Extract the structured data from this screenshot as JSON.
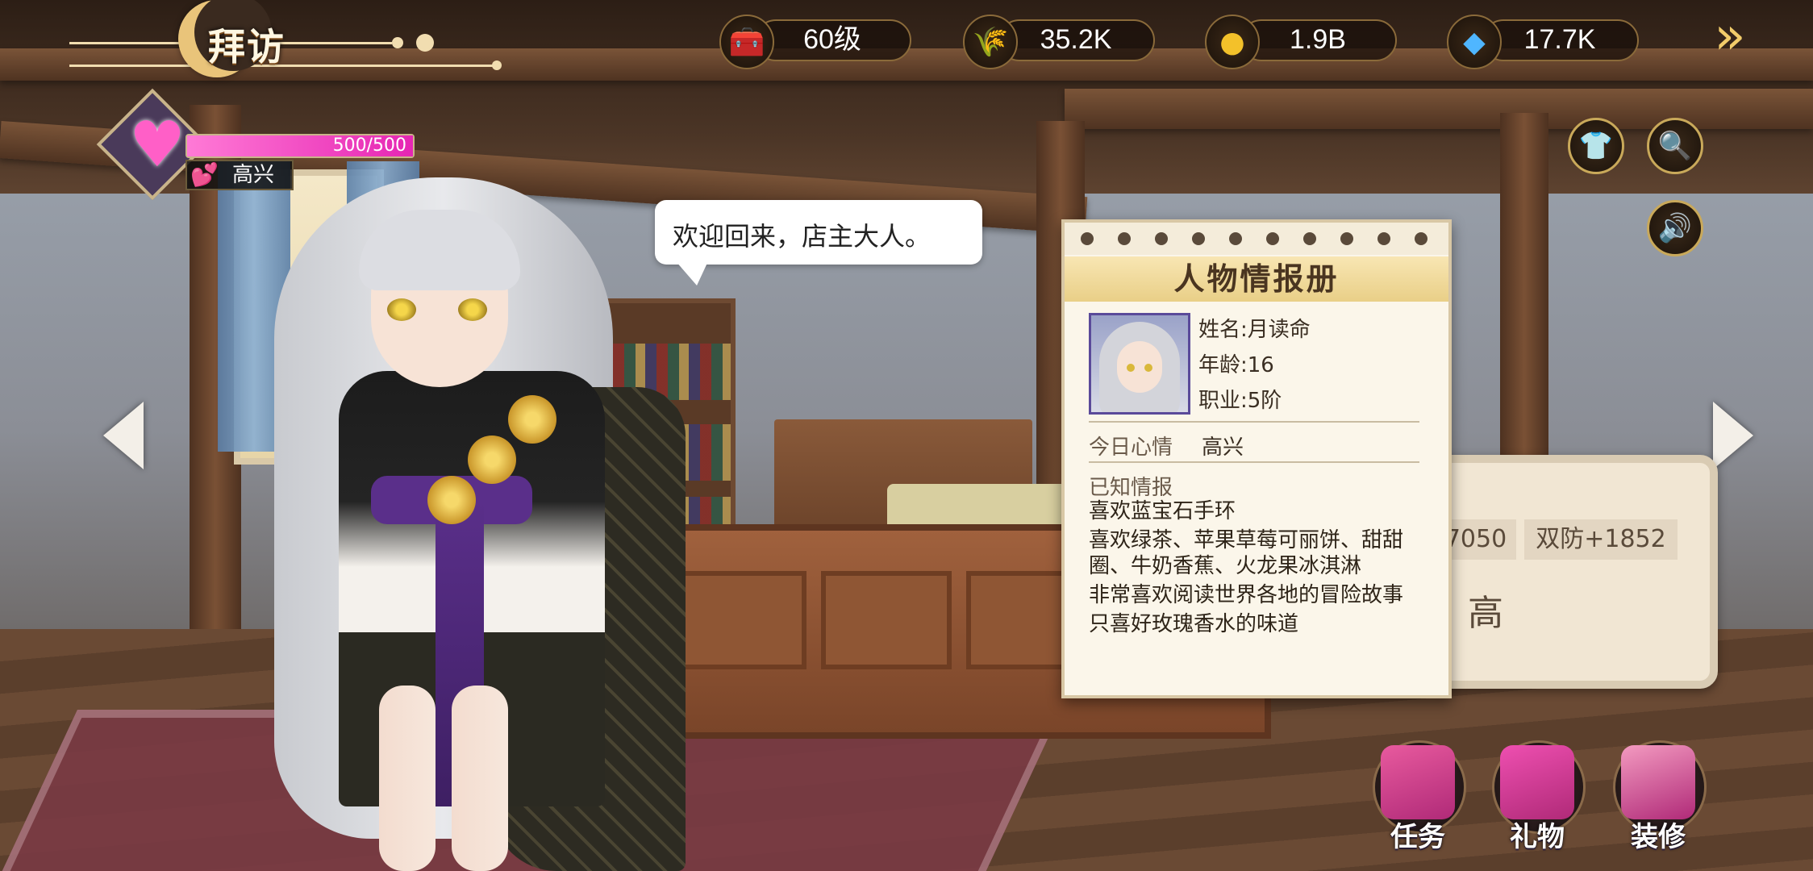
{
  "header": {
    "title": "拜访",
    "back_icon": "double-chevron-right-icon"
  },
  "resources": [
    {
      "name": "level",
      "icon": "treasure-chest-icon",
      "value": "60级"
    },
    {
      "name": "wheat",
      "icon": "grain-sack-icon",
      "value": "35.2K"
    },
    {
      "name": "gold",
      "icon": "gold-coin-icon",
      "value": "1.9B"
    },
    {
      "name": "diamond",
      "icon": "diamond-plus-icon",
      "value": "17.7K"
    }
  ],
  "affection": {
    "hp_text": "500/500",
    "fraction": 1.0,
    "mood": "高兴",
    "color": "#e626b3"
  },
  "side_buttons": {
    "outfit_icon": "shirt-icon",
    "search_icon": "magnifier-icon",
    "sound_icon": "speaker-icon"
  },
  "speech": {
    "text": "欢迎回来，店主大人。"
  },
  "notebook": {
    "title": "人物情报册",
    "name": "姓名:月读命",
    "age": "年龄:16",
    "rank": "职业:5阶",
    "mood_label": "今日心情",
    "mood_value": "高兴",
    "known_label": "已知情报",
    "known_items": [
      "喜欢蓝宝石手环",
      "喜欢绿茶、苹果草莓可丽饼、甜甜圈、牛奶香蕉、火龙果冰淇淋",
      "非常喜欢阅读世界各地的冒险故事",
      "只喜好玫瑰香水的味道"
    ]
  },
  "stats_card": {
    "cell1": "7050",
    "cell2": "双防+1852",
    "grade": "高"
  },
  "actions": [
    {
      "label": "任务",
      "icon": "spellbook-icon",
      "color": "#e85a9e"
    },
    {
      "label": "礼物",
      "icon": "gift-box-icon",
      "color": "#ee4fb0"
    },
    {
      "label": "装修",
      "icon": "wardrobe-icon",
      "color": "#f39ac0"
    }
  ]
}
